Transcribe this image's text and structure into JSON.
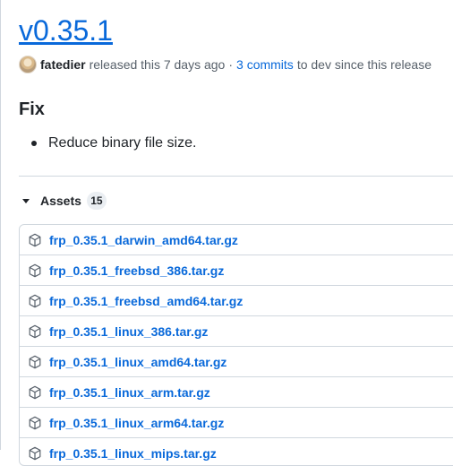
{
  "release": {
    "title": "v0.35.1",
    "author": "fatedier",
    "released_text": "released this 7 days ago",
    "separator": "·",
    "commits_link": "3 commits",
    "commits_suffix": "to dev since this release"
  },
  "notes": {
    "heading": "Fix",
    "items": [
      "Reduce binary file size."
    ]
  },
  "assets": {
    "label": "Assets",
    "count": "15",
    "files": [
      "frp_0.35.1_darwin_amd64.tar.gz",
      "frp_0.35.1_freebsd_386.tar.gz",
      "frp_0.35.1_freebsd_amd64.tar.gz",
      "frp_0.35.1_linux_386.tar.gz",
      "frp_0.35.1_linux_amd64.tar.gz",
      "frp_0.35.1_linux_arm.tar.gz",
      "frp_0.35.1_linux_arm64.tar.gz",
      "frp_0.35.1_linux_mips.tar.gz"
    ]
  },
  "colors": {
    "link": "#0969da",
    "border": "#d0d7de",
    "muted": "#57606a",
    "text": "#1f2328"
  },
  "icons": {
    "asset": "package-icon",
    "toggle": "triangle-down-icon"
  }
}
